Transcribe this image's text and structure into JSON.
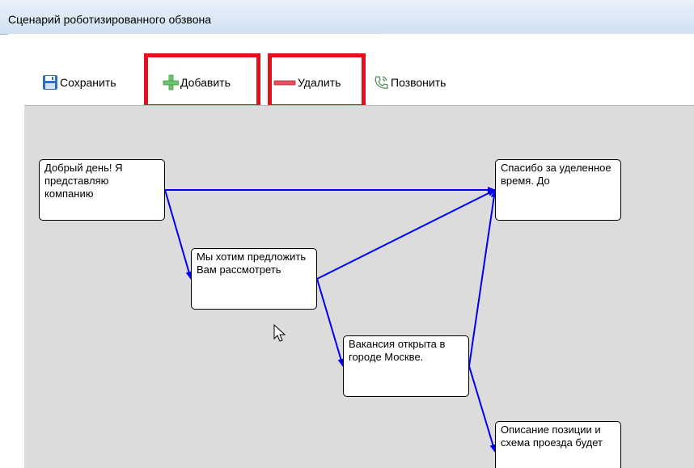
{
  "window": {
    "title": "Сценарий роботизированного обзвона"
  },
  "toolbar": {
    "save_label": "Сохранить",
    "add_label": "Добавить",
    "delete_label": "Удалить",
    "call_label": "Позвонить"
  },
  "highlight_color": "#e0101c",
  "edge_color": "#0000ee",
  "canvas_color": "#dcdcdc",
  "icons": {
    "save": "floppy-disk-icon",
    "add": "green-plus-icon",
    "delete": "red-minus-icon",
    "call": "phone-icon"
  },
  "nodes": [
    {
      "id": "greeting",
      "text": "Добрый день! Я представляю компанию"
    },
    {
      "id": "offer",
      "text": "Мы хотим предложить Вам рассмотреть"
    },
    {
      "id": "vacancy",
      "text": "Вакансия открыта в городе Москве."
    },
    {
      "id": "thanks",
      "text": "Спасибо за уделенное время. До"
    },
    {
      "id": "description",
      "text": "Описание позиции и схема проезда будет"
    }
  ],
  "edges": [
    {
      "from": "greeting",
      "to": "thanks"
    },
    {
      "from": "greeting",
      "to": "offer"
    },
    {
      "from": "offer",
      "to": "thanks"
    },
    {
      "from": "offer",
      "to": "vacancy"
    },
    {
      "from": "vacancy",
      "to": "thanks"
    },
    {
      "from": "vacancy",
      "to": "description"
    }
  ]
}
